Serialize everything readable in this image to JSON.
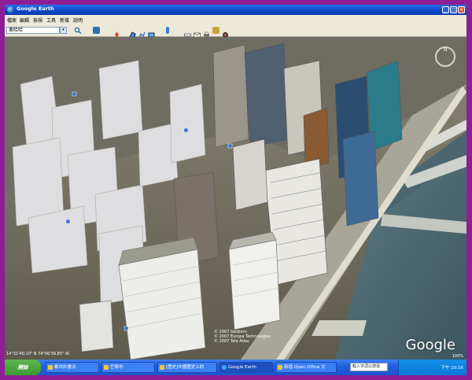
{
  "window": {
    "title": "Google Earth",
    "buttons": {
      "minimize": "_",
      "maximize": "□",
      "close": "×"
    }
  },
  "menu": [
    {
      "label": "檔案"
    },
    {
      "label": "編輯"
    },
    {
      "label": "檢視"
    },
    {
      "label": "工具"
    },
    {
      "label": "新增"
    },
    {
      "label": "說明"
    }
  ],
  "toolbar": {
    "search_value": "奥哈哈",
    "icons": [
      "sidebar-icon",
      "placemark-icon",
      "polygon-icon",
      "path-icon",
      "overlay-icon",
      "tour-icon",
      "ruler-icon",
      "email-icon",
      "print-icon",
      "map-icon",
      "sky-icon"
    ]
  },
  "viewport": {
    "compass_letter": "N",
    "logo": "Google",
    "copyright_lines": [
      "© 2007 Sanborn",
      "© 2007 Europa Technologies",
      "© 2007 Tele Atlas"
    ],
    "pointer": "14°31'40.10\" N 74°00'39.85\" W",
    "streaming": "100%"
  },
  "taskbar": {
    "start_label": "開始",
    "tasks": [
      {
        "label": "都市計畫法"
      },
      {
        "label": "巴黎市"
      },
      {
        "label": "[歷史]中國歷史上的"
      },
      {
        "label": "Google Earth"
      },
      {
        "label": "新增 Open Office 文"
      }
    ],
    "ime_placeholder": "輸入字詞以搜尋",
    "clock": "下午 10:16"
  },
  "colors": {
    "desktop_border": "#8e1e96",
    "titlebar": "#0a46c8",
    "taskbar": "#245edb",
    "start": "#3c9a34"
  }
}
